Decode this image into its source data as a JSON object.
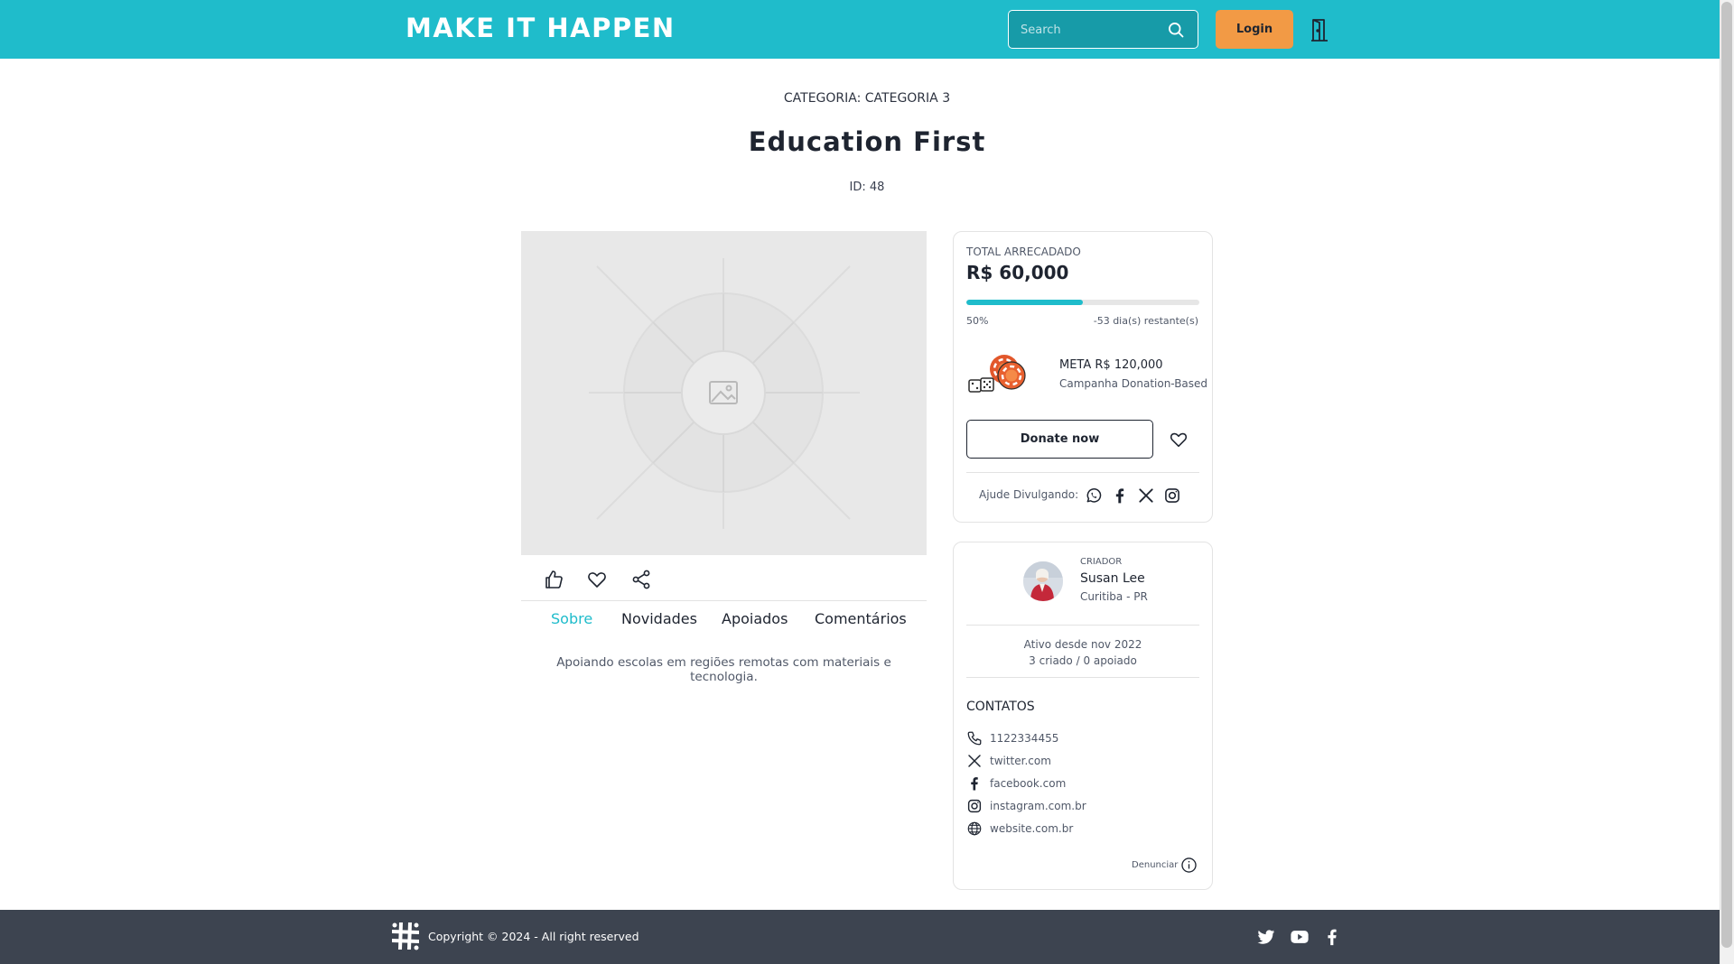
{
  "header": {
    "logo": "MAKE IT HAPPEN",
    "search_placeholder": "Search",
    "login_label": "Login"
  },
  "project": {
    "category_line": "CATEGORIA: CATEGORIA 3",
    "title": "Education First",
    "id_line": "ID: 48",
    "about": "Apoiando escolas em regiões remotas com materiais e tecnologia."
  },
  "tabs": [
    {
      "label": "Sobre",
      "active": true
    },
    {
      "label": "Novidades",
      "active": false
    },
    {
      "label": "Apoiados",
      "active": false
    },
    {
      "label": "Comentários",
      "active": false
    }
  ],
  "funding": {
    "total_label": "TOTAL ARRECADADO",
    "amount": "R$ 60,000",
    "progress_percent": 50,
    "percent_label": "50%",
    "days_label": "-53 dia(s) restante(s)",
    "goal_label": "META R$ 120,000",
    "campaign_type": "Campanha Donation-Based",
    "donate_label": "Donate now",
    "share_label": "Ajude Divulgando:"
  },
  "creator": {
    "label": "CRIADOR",
    "name": "Susan Lee",
    "location": "Curitiba - PR",
    "active_since": "Ativo desde nov 2022",
    "stats": "3 criado / 0 apoiado",
    "contacts_title": "CONTATOS",
    "contacts": [
      {
        "icon": "phone-icon",
        "text": "1122334455"
      },
      {
        "icon": "x-icon",
        "text": "twitter.com"
      },
      {
        "icon": "facebook-icon",
        "text": "facebook.com"
      },
      {
        "icon": "instagram-icon",
        "text": "instagram.com.br"
      },
      {
        "icon": "globe-icon",
        "text": "website.com.br"
      }
    ],
    "report_label": "Denunciar"
  },
  "footer": {
    "copyright": "Copyright © 2024 - All right reserved"
  },
  "colors": {
    "brand": "#1fbccb",
    "login": "#f29a45",
    "footer": "#3d4450"
  }
}
